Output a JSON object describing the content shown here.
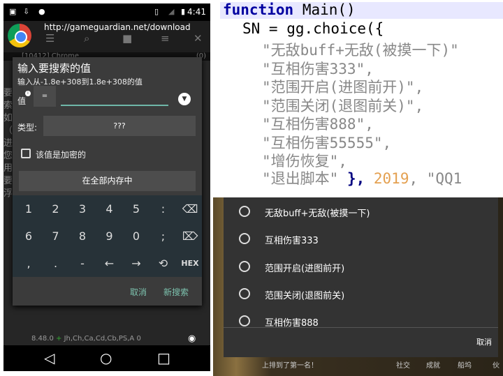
{
  "left_phone": {
    "status": {
      "time": "4:41",
      "icons": [
        "image-icon",
        "download-icon",
        "android-icon",
        "vibrate-icon",
        "no-signal-icon",
        "battery-charging-icon"
      ]
    },
    "browser": {
      "url": "http://gameguardian.net/download"
    },
    "process": {
      "label": "[10412] Chrome",
      "count": "(0)"
    },
    "background_text": "要索如（搜进您用要浮",
    "dialog": {
      "title": "输入要搜索的值",
      "subtitle": "输入从-1.8e+308到1.8e+308的值",
      "value_label": "值",
      "operator": "=",
      "value": "",
      "type_label": "类型:",
      "type_value": "???",
      "encrypted_label": "该值是加密的",
      "encrypted_checked": false,
      "memory_button": "在全部内存中",
      "keys": [
        [
          "1",
          "2",
          "3",
          "4",
          "5",
          ":",
          "⌫"
        ],
        [
          "6",
          "7",
          "8",
          "9",
          "0",
          ";",
          "⌦"
        ],
        [
          ",",
          ".",
          "-",
          "←",
          "→",
          "⟲",
          "HEX"
        ]
      ],
      "cancel": "取消",
      "new_search": "新搜索"
    },
    "version": "8.48.0",
    "flags": "Jh,Ch,Ca,Cd,Cb,PS,A",
    "flags_count": "0"
  },
  "code": {
    "line1_kw": "function",
    "line1_rest": "Main()",
    "line2": "SN = gg.choice({",
    "items": [
      "\"无敌buff+无敌(被摸一下)\"",
      "\"互相伤害333\",",
      "\"范围开启(进图前开)\",",
      "\"范围关闭(退图前关)\",",
      "\"互相伤害888\",",
      "\"互相伤害55555\",",
      "\"增伤恢复\","
    ],
    "last_str": "\"退出脚本\"",
    "last_brace": " },",
    "last_num": "2019",
    "last_tail": ", \"QQ1"
  },
  "choice_dialog": {
    "options": [
      "无敌buff+无敌(被摸一下)",
      "互相伤害333",
      "范围开启(进图前开)",
      "范围关闭(退图前关)",
      "互相伤害888"
    ],
    "cancel": "取消"
  },
  "game_footer": {
    "message": "上排到了第一名！",
    "tabs": [
      "社交",
      "成就",
      "船坞",
      "伙"
    ]
  },
  "colors": {
    "accent": "#7cc1ad",
    "keyboard": "#273238",
    "dialog": "#3b3b3b",
    "keyword": "#0000a0"
  }
}
